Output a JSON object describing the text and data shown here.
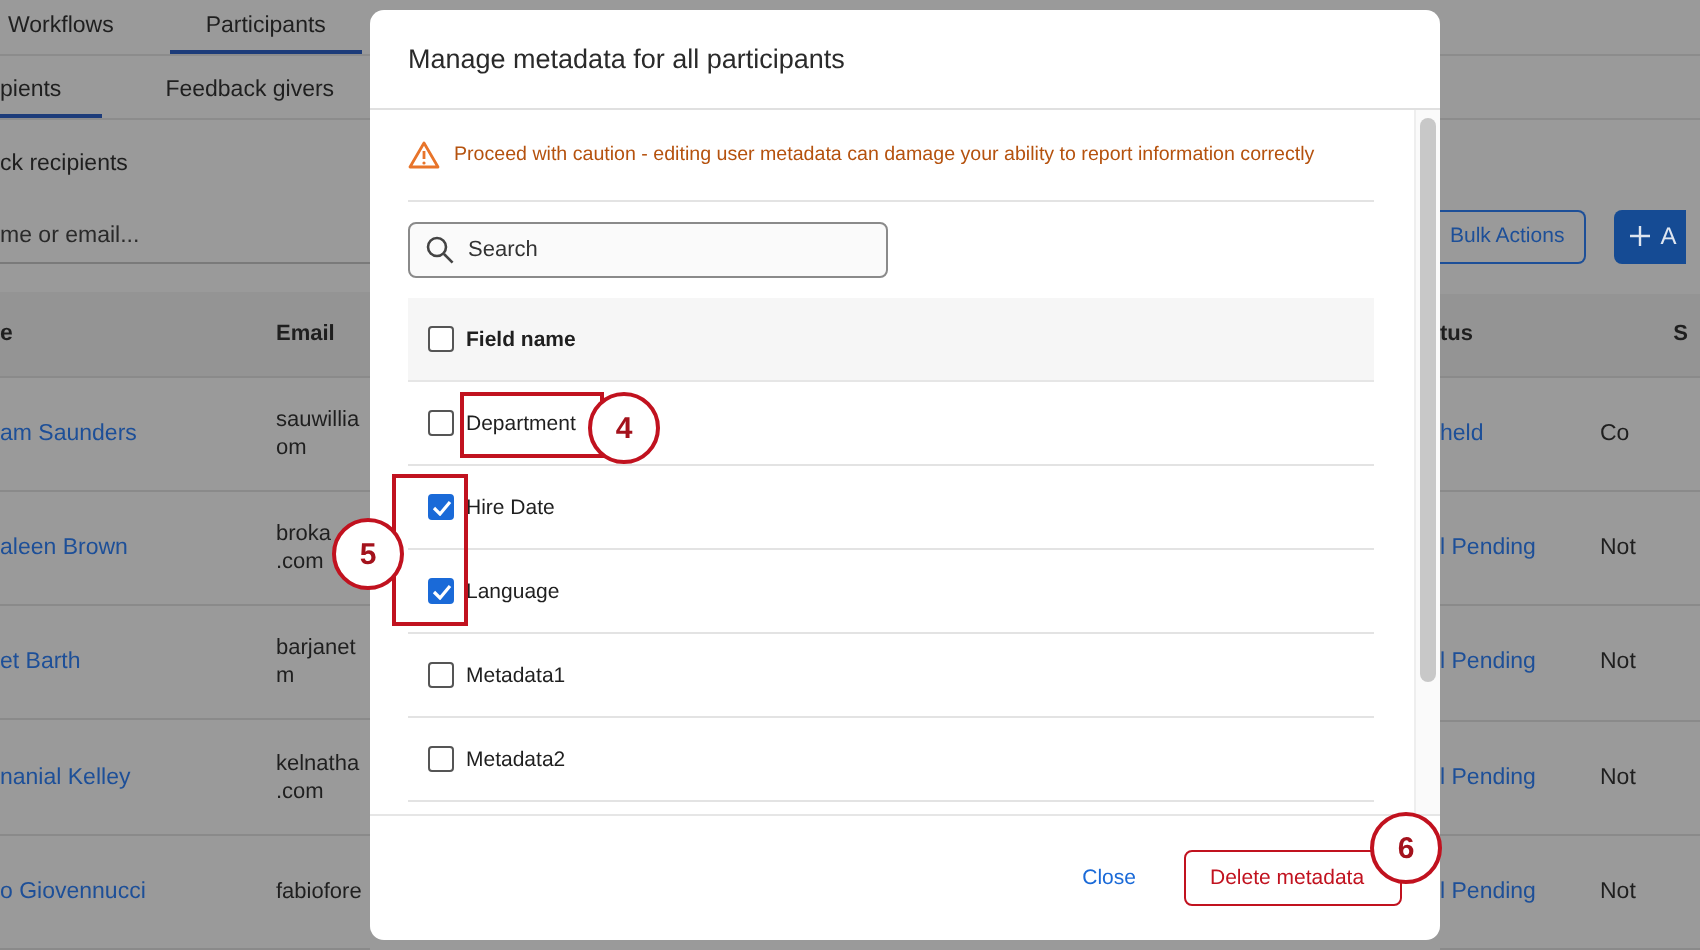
{
  "background": {
    "tabs": [
      {
        "label": "Workflows",
        "selected": false
      },
      {
        "label": "Participants",
        "selected": true
      }
    ],
    "subtabs": [
      {
        "label": "pients",
        "selected": true
      },
      {
        "label": "Feedback givers",
        "selected": false
      }
    ],
    "heading": "ck recipients",
    "search": {
      "placeholder": "me or email..."
    },
    "bulk_button": "Bulk Actions",
    "add_button": "A",
    "columns_left": [
      "e",
      "Email"
    ],
    "columns_right": [
      "tus",
      "S"
    ],
    "rows": [
      {
        "name": "am Saunders",
        "email": [
          "sauwillia",
          "om"
        ],
        "status": "held",
        "column_5": "Co"
      },
      {
        "name": "aleen Brown",
        "email": [
          "broka",
          ".com"
        ],
        "status": "l Pending",
        "column_5": "Not"
      },
      {
        "name": "et Barth",
        "email": [
          "barjanet",
          "m"
        ],
        "status": "l Pending",
        "column_5": "Not"
      },
      {
        "name": "nanial Kelley",
        "email": [
          "kelnatha",
          ".com"
        ],
        "status": "l Pending",
        "column_5": "Not"
      },
      {
        "name": "o Giovennucci",
        "email": [
          "fabiofore"
        ],
        "status": "l Pending",
        "column_5": "Not"
      }
    ]
  },
  "dialog": {
    "title": "Manage metadata for all participants",
    "warning": "Proceed with caution - editing user metadata can damage your ability to report information correctly",
    "search": {
      "placeholder": "Search"
    },
    "header": {
      "label": "Field name",
      "checked": false
    },
    "fields": [
      {
        "label": "Department",
        "checked": false
      },
      {
        "label": "Hire Date",
        "checked": true
      },
      {
        "label": "Language",
        "checked": true
      },
      {
        "label": "Metadata1",
        "checked": false
      },
      {
        "label": "Metadata2",
        "checked": false
      }
    ],
    "buttons": [
      {
        "label": "Close",
        "kind": "link"
      },
      {
        "label": "Delete metadata",
        "kind": "danger"
      }
    ]
  },
  "annotations": [
    {
      "label": "4",
      "kind": "box"
    },
    {
      "label": "5",
      "kind": "box"
    },
    {
      "label": "6",
      "kind": "circle"
    }
  ]
}
